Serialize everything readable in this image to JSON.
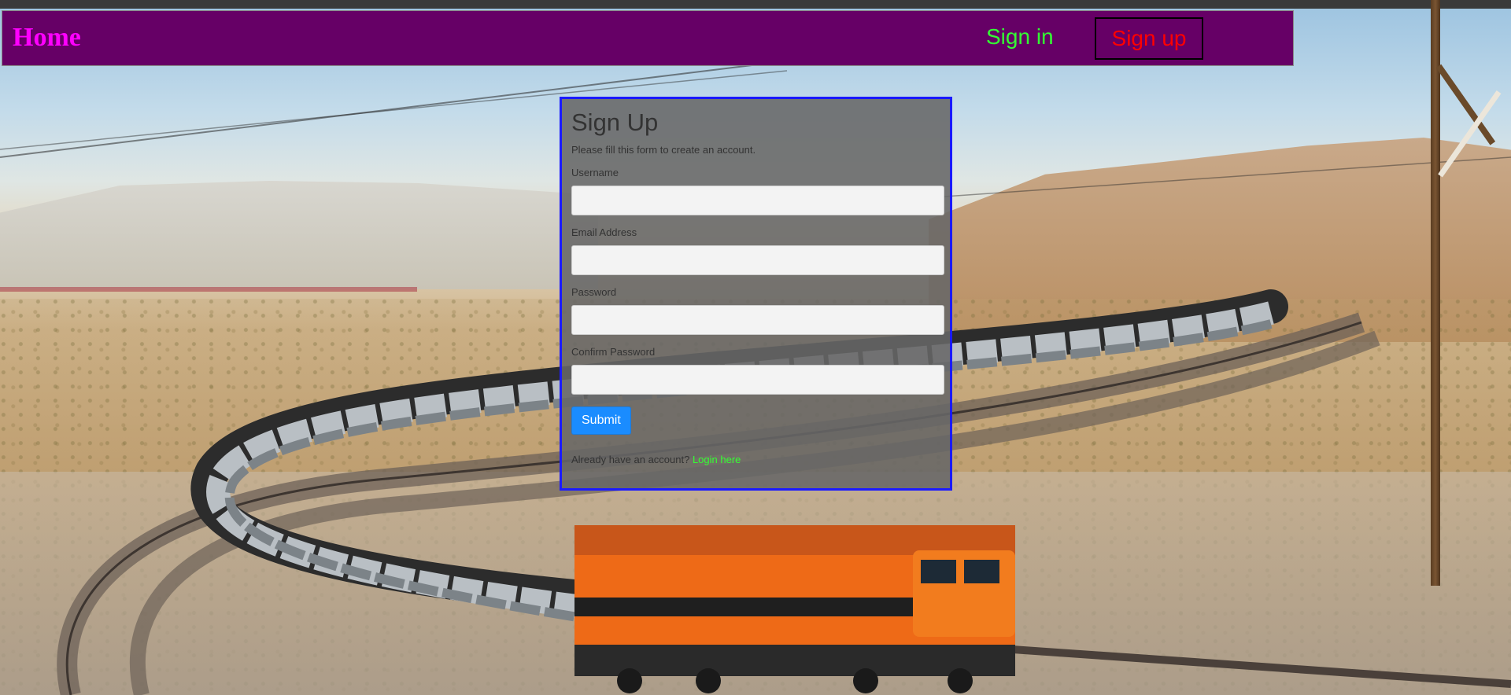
{
  "navbar": {
    "brand": "Home",
    "signin": "Sign in",
    "signup": "Sign up"
  },
  "form": {
    "title": "Sign Up",
    "subtitle": "Please fill this form to create an account.",
    "fields": [
      {
        "label": "Username",
        "value": "",
        "placeholder": ""
      },
      {
        "label": "Email Address",
        "value": "",
        "placeholder": ""
      },
      {
        "label": "Password",
        "value": "",
        "placeholder": ""
      },
      {
        "label": "Confirm Password",
        "value": "",
        "placeholder": ""
      }
    ],
    "submit_label": "Submit",
    "login_prompt": "Already have an account?",
    "login_link": "Login here"
  },
  "colors": {
    "navbar_bg": "#660066",
    "brand": "#ff00ff",
    "signin": "#33ff33",
    "signup": "#ff0000",
    "card_border": "#1a1aff",
    "submit_bg": "#1a8cff",
    "login_link": "#33ff33"
  }
}
